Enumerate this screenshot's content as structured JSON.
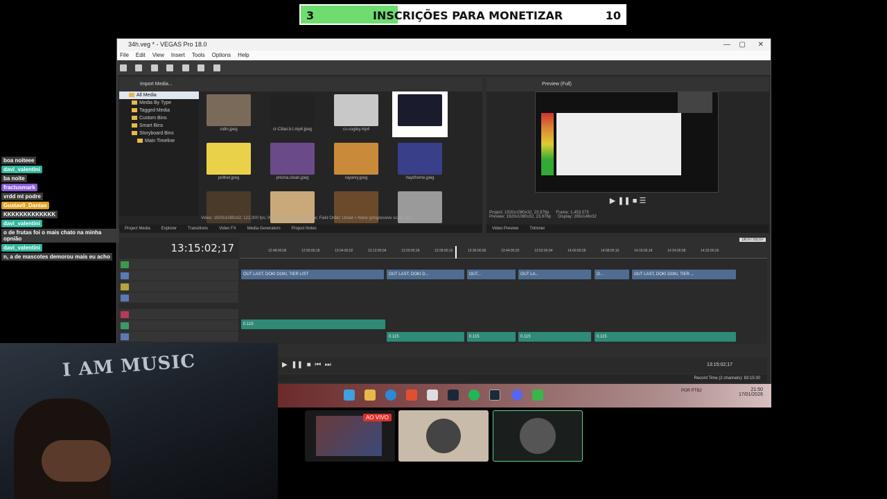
{
  "goal": {
    "current": "3",
    "label": "INSCRIÇÕES PARA MONETIZAR",
    "target": "10",
    "progress": 0.3,
    "fill_color": "#6fdc6f"
  },
  "window": {
    "title": "34h.veg * - VEGAS Pro 18.0"
  },
  "menu": [
    "File",
    "Edit",
    "View",
    "Insert",
    "Tools",
    "Options",
    "Help"
  ],
  "explorer": {
    "toolbar_label": "Import Media...",
    "tree": [
      {
        "label": "All Media",
        "selected": true
      },
      {
        "label": "Media By Type"
      },
      {
        "label": "Tagged Media"
      },
      {
        "label": "Custom Bins"
      },
      {
        "label": "Smart Bins"
      },
      {
        "label": "Storyboard Bins"
      },
      {
        "label": "Main Timeline"
      }
    ],
    "thumbs": [
      {
        "label": "cidin.jpeg",
        "color": "#7a6a5a"
      },
      {
        "label": "cr-C8ao.b.t.mp4.jpeg",
        "color": "#222222"
      },
      {
        "label": "cs-cogley.mp4",
        "color": "#c8c8c8"
      },
      {
        "label": "",
        "color": "#1b1b2e"
      },
      {
        "label": "pollnel.jpeg",
        "color": "#e9d24a"
      },
      {
        "label": "prisma.clean.jpeg",
        "color": "#6b4a8a"
      },
      {
        "label": "rayanry.jpeg",
        "color": "#c98b3a"
      },
      {
        "label": "rlaydhome.jpeg",
        "color": "#3a3f8a"
      },
      {
        "label": "",
        "color": "#4a3a2a"
      },
      {
        "label": "",
        "color": "#c9a87a"
      },
      {
        "label": "",
        "color": "#6a4a2a"
      },
      {
        "label": "",
        "color": "#9a9a9a"
      }
    ],
    "media_info": "Video: 1920x1080x32; 122,000 fps; 00:07:30;02; Alpha = None; Field Order: Unset = None (progressive scan); AVC",
    "tabs": [
      "Project Media",
      "Explorer",
      "Transitions",
      "Video FX",
      "Media Generators",
      "Project Notes"
    ]
  },
  "preview": {
    "toolbar_label": "Preview (Full)",
    "info_project": "Project: 1920x1080x32, 23,976p",
    "info_preview": "Preview: 1920x1080x32, 23,976p",
    "info_frame": "Frame: 1,453,575",
    "info_display": "Display: 265x146x32",
    "tabs": [
      "Video Preview",
      "Trimmer"
    ]
  },
  "timeline": {
    "timecode": "13:15:02;17",
    "ruler_marks": [
      "12:48:00;06",
      "12:56:00;18",
      "13:04:00;02",
      "13:12:00;04",
      "13:20:00;18",
      "13:28:00;16",
      "13:36:00;06",
      "13:44:00;20",
      "13:52:00;04",
      "14:00:00;28",
      "14:08:00;16",
      "14:16:00;18",
      "14:24:00;08",
      "14:32:00;26"
    ],
    "end_marker": "16:07:05;07",
    "video_clips": [
      {
        "label": "OUT LAST, DOKI DOKI, TIER LIST"
      },
      {
        "label": "OUT LAST, DOKI D..."
      },
      {
        "label": "OUT..."
      },
      {
        "label": "OUT LA..."
      },
      {
        "label": "O..."
      },
      {
        "label": "OUT LAST, DOKI DOKI, TIER ..."
      }
    ],
    "audio_clip_a": "0.115",
    "audio_clips_b": [
      "0.115",
      "0.115",
      "0.115",
      "0.115"
    ],
    "transport_time": "13:15:02;17",
    "status": "Record Time (2 channels): 83:15:30"
  },
  "taskbar": {
    "lang": "POR PTB2",
    "time": "21:50",
    "date": "17/01/2026"
  },
  "chat": [
    {
      "type": "text",
      "text": "boa noiteee"
    },
    {
      "type": "user",
      "text": "davi_valentini",
      "color": "#2fb59e"
    },
    {
      "type": "text",
      "text": "ba noite"
    },
    {
      "type": "user",
      "text": "fractusmark",
      "color": "#8a5ad8"
    },
    {
      "type": "text",
      "text": "vrdd mt podre"
    },
    {
      "type": "user",
      "text": "Gustav0_Dantas",
      "color": "#e0a020"
    },
    {
      "type": "text",
      "text": "KKKKKKKKKKKKK"
    },
    {
      "type": "user",
      "text": "davi_valentini",
      "color": "#2fb59e"
    },
    {
      "type": "text",
      "text": "o de frutas foi o mais chato na minha opnião"
    },
    {
      "type": "user",
      "text": "davi_valentini",
      "color": "#2fb59e"
    },
    {
      "type": "text",
      "text": "n, a de mascotes demorou mais eu acho"
    }
  ],
  "webcam": {
    "shirt_text": "I AM MUSIC"
  },
  "live_badge": "AO VIVO"
}
